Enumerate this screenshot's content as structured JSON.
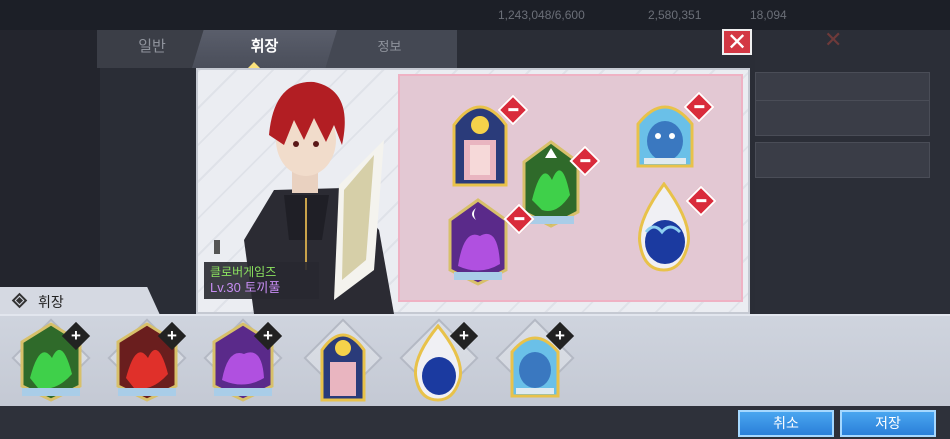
{
  "hud": {
    "gold": "1,243,048/6,600",
    "gems": "2,580,351",
    "stamina": "18,094"
  },
  "tabs": {
    "general": "일반",
    "emblem": "휘장",
    "info": "정보"
  },
  "character": {
    "guild": "클로버게임즈",
    "level": "Lv.30 토끼풀"
  },
  "inventory": {
    "title": "휘장"
  },
  "buttons": {
    "cancel": "취소",
    "save": "저장"
  },
  "colors": {
    "accent": "#2a7fd8",
    "close": "#d33844",
    "board": "#e3c8d3"
  },
  "icons": {
    "placed": [
      "stained-glass-icon",
      "blue-spirit-icon",
      "green-dragon-icon",
      "purple-moon-icon",
      "blue-wave-icon"
    ],
    "inventory": [
      "green-dragon-icon",
      "red-dragon-icon",
      "purple-moon-icon",
      "stained-glass-icon",
      "blue-wave-icon",
      "blue-spirit-icon"
    ]
  }
}
